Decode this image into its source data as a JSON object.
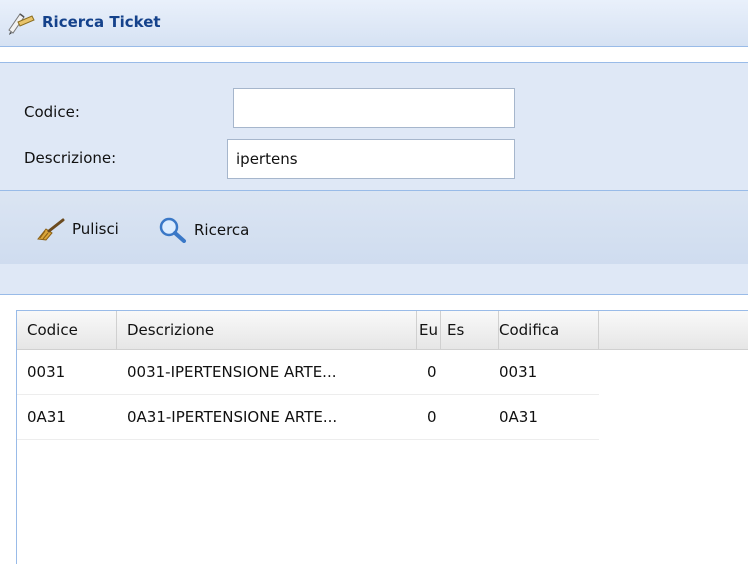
{
  "header": {
    "title": "Ricerca Ticket",
    "icon": "pencil-ruler-icon"
  },
  "form": {
    "codice_label": "Codice:",
    "codice_value": "",
    "descrizione_label": "Descrizione:",
    "descrizione_value": "ipertens"
  },
  "toolbar": {
    "pulisci_label": "Pulisci",
    "ricerca_label": "Ricerca"
  },
  "grid": {
    "columns": [
      "Codice",
      "Descrizione",
      "Eu",
      "Es",
      "Codifica"
    ],
    "rows": [
      {
        "codice": "0031",
        "descrizione": "0031-IPERTENSIONE ARTE...",
        "eu": "0",
        "es": "",
        "codifica": "0031"
      },
      {
        "codice": "0A31",
        "descrizione": "0A31-IPERTENSIONE ARTE...",
        "eu": "0",
        "es": "",
        "codifica": "0A31"
      }
    ]
  }
}
